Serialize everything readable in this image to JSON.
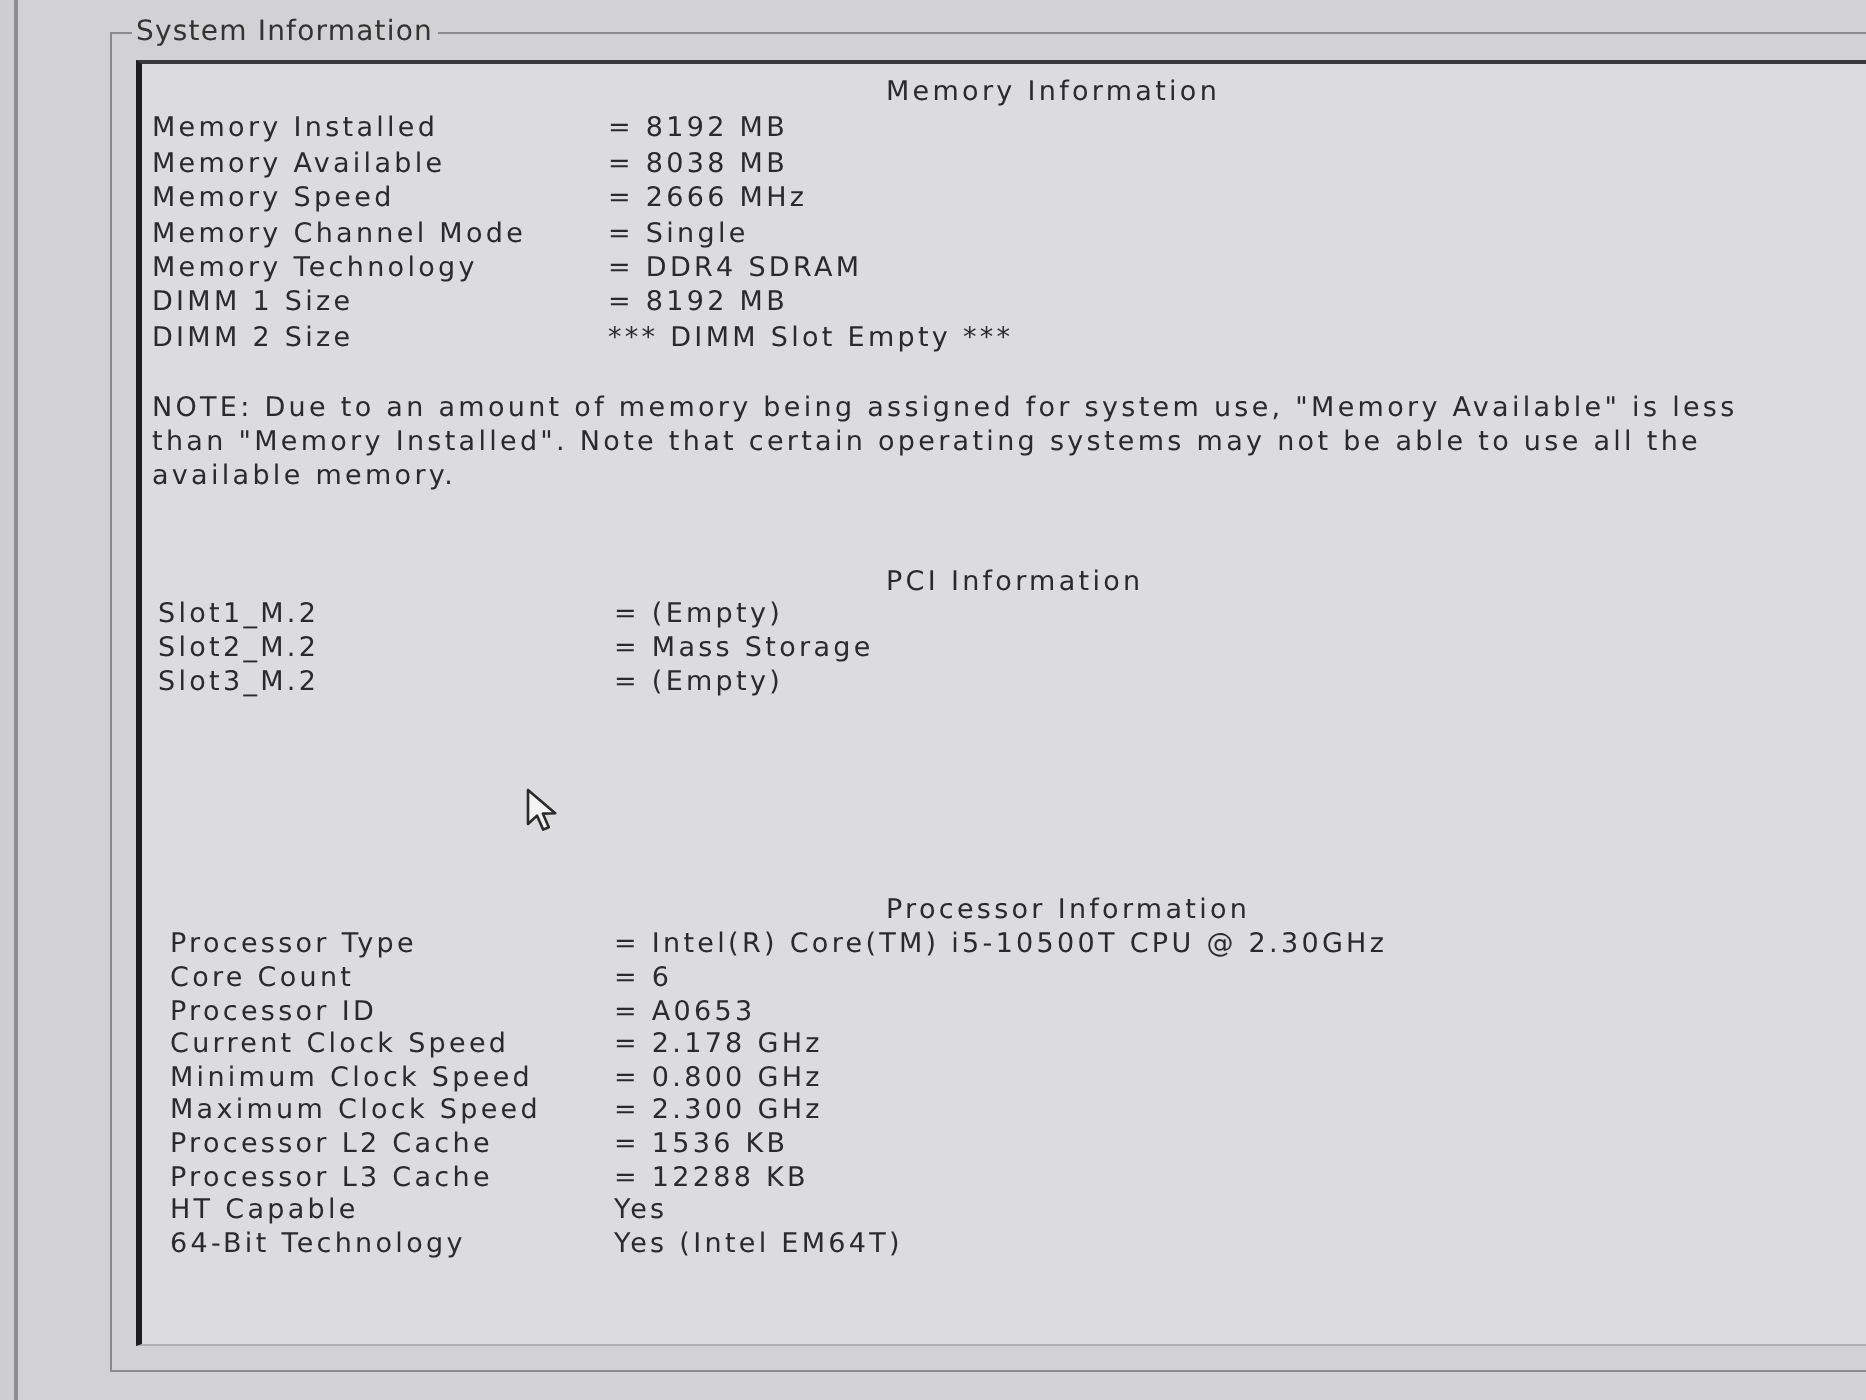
{
  "panel": {
    "title": "System Information"
  },
  "sections": [
    {
      "title": "Memory Information",
      "rows": [
        {
          "label": "Memory Installed",
          "value": "= 8192 MB"
        },
        {
          "label": "Memory Available",
          "value": "= 8038 MB"
        },
        {
          "label": "Memory Speed",
          "value": "= 2666 MHz"
        },
        {
          "label": "Memory Channel Mode",
          "value": "= Single"
        },
        {
          "label": "Memory Technology",
          "value": "= DDR4 SDRAM"
        },
        {
          "label": "DIMM 1 Size",
          "value": "= 8192 MB"
        },
        {
          "label": "DIMM 2 Size",
          "value": "*** DIMM Slot Empty ***"
        }
      ],
      "note": "NOTE: Due to an amount of memory being assigned for system use, \"Memory Available\" is less than \"Memory Installed\". Note that certain operating systems may not be able to use all the available memory."
    },
    {
      "title": "PCI Information",
      "rows": [
        {
          "label": "Slot1_M.2",
          "value": "= (Empty)"
        },
        {
          "label": "Slot2_M.2",
          "value": "= Mass Storage"
        },
        {
          "label": "Slot3_M.2",
          "value": "= (Empty)"
        }
      ]
    },
    {
      "title": "Processor Information",
      "rows": [
        {
          "label": "Processor Type",
          "value": "= Intel(R) Core(TM) i5-10500T CPU @ 2.30GHz"
        },
        {
          "label": "Core Count",
          "value": "= 6"
        },
        {
          "label": "Processor ID",
          "value": "= A0653"
        },
        {
          "label": "Current Clock Speed",
          "value": "= 2.178 GHz"
        },
        {
          "label": "Minimum Clock Speed",
          "value": "= 0.800 GHz"
        },
        {
          "label": "Maximum Clock Speed",
          "value": "= 2.300 GHz"
        },
        {
          "label": "Processor L2 Cache",
          "value": "= 1536 KB"
        },
        {
          "label": "Processor L3 Cache",
          "value": "= 12288 KB"
        },
        {
          "label": "HT Capable",
          "value": "Yes"
        },
        {
          "label": "64-Bit Technology",
          "value": "Yes (Intel EM64T)"
        }
      ]
    }
  ]
}
